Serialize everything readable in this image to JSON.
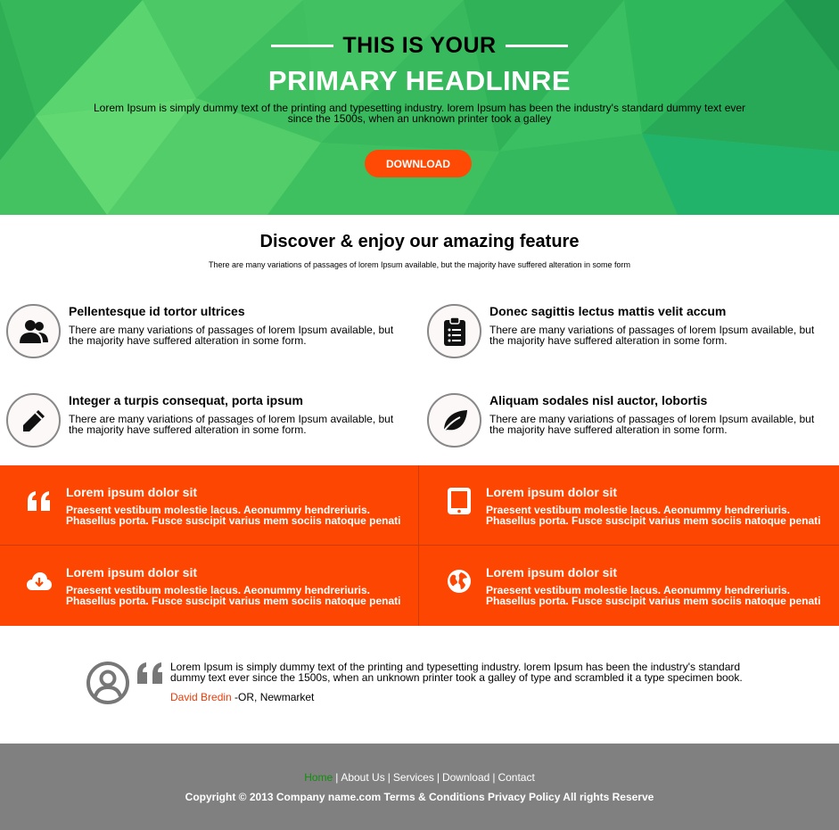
{
  "hero": {
    "subheadline": "THIS IS YOUR",
    "headline": "PRIMARY HEADLINRE",
    "text": "Lorem Ipsum is simply dummy text of the printing and typesetting industry. lorem Ipsum has been the industry's standard dummy text ever since the 1500s, when an unknown printer took a galley",
    "download_label": "DOWNLOAD",
    "accent": "#fe4a04",
    "bg_color": "#3cc163"
  },
  "features": {
    "title_prefix": "Discover & enjoy our ",
    "title_bold": "amazing feature",
    "subtitle": "There are many variations of passages of lorem Ipsum available, but the majority have suffered alteration in some form",
    "items": [
      {
        "icon": "users-icon",
        "title": "Pellentesque id tortor ultrices",
        "text": "There are many variations of passages of lorem Ipsum available, but the majority have suffered alteration in some form."
      },
      {
        "icon": "clipboard-list-icon",
        "title": "Donec sagittis lectus mattis velit accum",
        "text": "There are many variations of passages of lorem Ipsum available, but the majority have suffered alteration in some form."
      },
      {
        "icon": "pencil-icon",
        "title": "Integer a turpis consequat, porta ipsum",
        "text": "There are many variations of passages of lorem Ipsum available, but the majority have suffered alteration in some form."
      },
      {
        "icon": "leaf-icon",
        "title": "Aliquam sodales nisl auctor, lobortis",
        "text": "There are many variations of passages of lorem Ipsum available, but the majority have suffered alteration in some form."
      }
    ]
  },
  "services": {
    "bg_color": "#fe4603",
    "items": [
      {
        "icon": "quote-icon",
        "title": "Lorem ipsum dolor sit",
        "text": "Praesent vestibum molestie lacus. Aeonummy hendreriuris. Phasellus porta. Fusce suscipit varius mem sociis natoque penati"
      },
      {
        "icon": "tablet-icon",
        "title": "Lorem ipsum dolor sit",
        "text": "Praesent vestibum molestie lacus. Aeonummy hendreriuris. Phasellus porta. Fusce suscipit varius mem sociis natoque penati"
      },
      {
        "icon": "cloud-download-icon",
        "title": "Lorem ipsum dolor sit",
        "text": "Praesent vestibum molestie lacus. Aeonummy hendreriuris. Phasellus porta. Fusce suscipit varius mem sociis natoque penati"
      },
      {
        "icon": "globe-icon",
        "title": "Lorem ipsum dolor sit",
        "text": "Praesent vestibum molestie lacus. Aeonummy hendreriuris. Phasellus porta. Fusce suscipit varius mem sociis natoque penati"
      }
    ]
  },
  "testimonial": {
    "text": "Lorem Ipsum is simply dummy text of the printing and typesetting industry. lorem Ipsum has been the industry's standard dummy text ever since the 1500s, when an unknown printer took a galley of type and scrambled it a type specimen book.",
    "author_name": "David Bredin",
    "author_location": " -OR, Newmarket",
    "author_color": "#e83e0a"
  },
  "footer": {
    "nav": [
      "Home",
      "About Us",
      "Services",
      "Download",
      "Contact"
    ],
    "active_color": "#0f8f0b",
    "copyright": "Copyright © 2013 Company name.com Terms & Conditions Privacy Policy All rights Reserve",
    "bg_color": "#808080"
  }
}
